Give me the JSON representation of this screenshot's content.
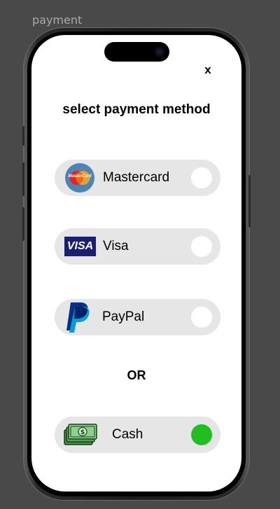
{
  "frame_label": "payment",
  "close_label": "x",
  "title": "select payment method",
  "options": [
    {
      "label": "Mastercard",
      "logo_text": "MasterCard",
      "selected": false
    },
    {
      "label": "Visa",
      "logo_text": "VISA",
      "selected": false
    },
    {
      "label": "PayPal",
      "selected": false
    }
  ],
  "separator": "OR",
  "cash": {
    "label": "Cash",
    "selected": true
  },
  "colors": {
    "canvas": "#4a4949",
    "option_background": "#e6e6e6",
    "selected_radio": "#1fbf1f",
    "unselected_radio": "#ffffff"
  }
}
